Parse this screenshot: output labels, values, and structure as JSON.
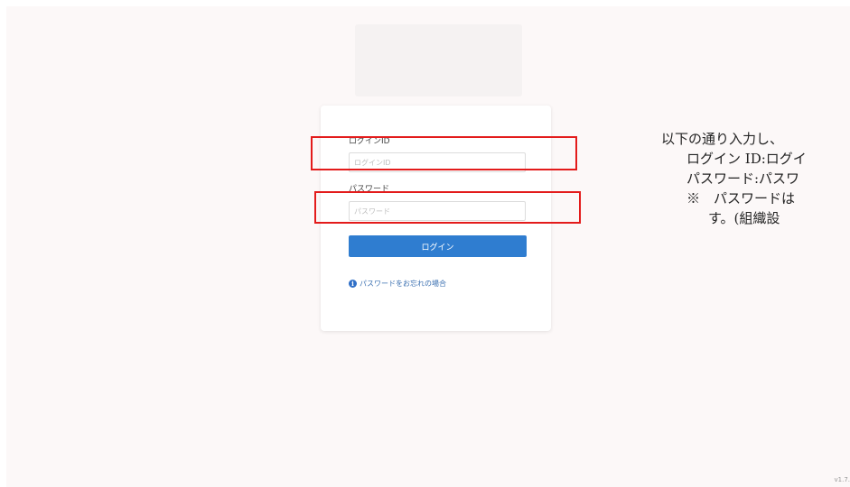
{
  "login": {
    "login_id_label": "ログインID",
    "login_id_placeholder": "ログインID",
    "password_label": "パスワード",
    "password_placeholder": "パスワード",
    "login_button_label": "ログイン",
    "forgot_password_label": "パスワードをお忘れの場合"
  },
  "instructions": {
    "line1": "以下の通り入力し、",
    "line2": "ログイン ID:ログイ",
    "line3": "パスワード:パスワ",
    "line4": "※　パスワードは",
    "line5": "す。(組織設"
  },
  "footer": {
    "version": "v1.7."
  },
  "icons": {
    "info": "info-icon"
  },
  "colors": {
    "accent_blue": "#2f7dd0",
    "highlight_red": "#e31b1b",
    "link_blue": "#3a6fb0"
  }
}
